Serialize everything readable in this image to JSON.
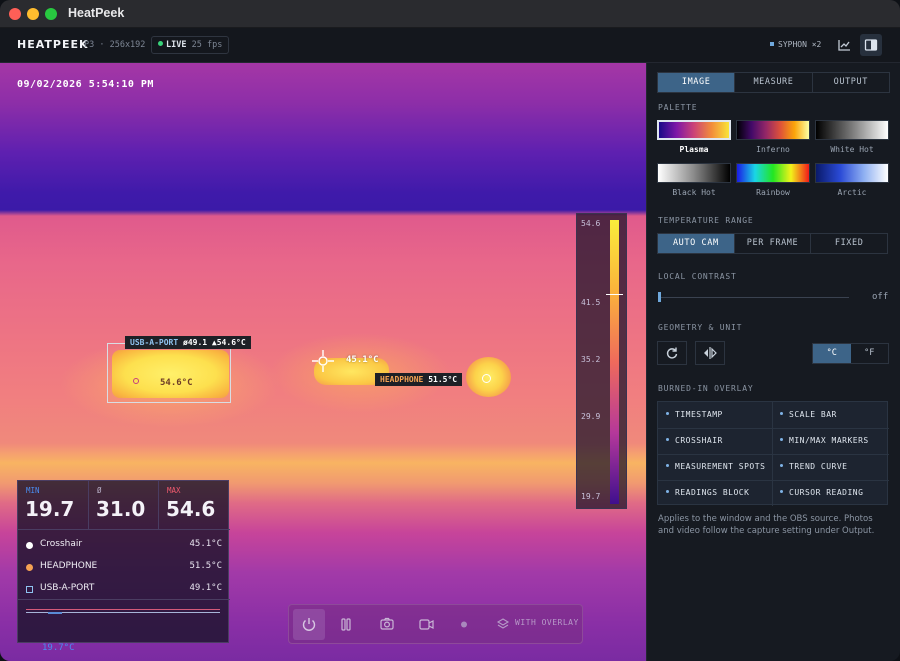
{
  "window": {
    "title": "HeatPeek"
  },
  "header": {
    "brand": "HEATPEEK",
    "camera": "P3 · 256x192",
    "live_label": "LIVE",
    "fps": "25 fps",
    "syphon": "SYPHON ×2"
  },
  "viewer": {
    "timestamp": "09/02/2026   5:54:10 PM",
    "usb_tag": {
      "name": "USB-A-PORT",
      "avg": "ø49.1",
      "max": "▲54.6°C"
    },
    "usb_point": "54.6°C",
    "crosshair_temp": "45.1°C",
    "headphone_tag": {
      "name": "HEADPHONE",
      "value": "51.5°C"
    },
    "scale_ticks": [
      "54.6",
      "41.5",
      "35.2",
      "29.9",
      "19.7"
    ],
    "scale_marker_value": 45.1,
    "palette_gradient": [
      "#f9ed3b",
      "#fbb33b",
      "#ef6a5c",
      "#b5389a",
      "#3f0f8e"
    ]
  },
  "readings": {
    "min_label": "MIN",
    "min_value": "19.7",
    "avg_label": "Ø",
    "avg_value": "31.0",
    "max_label": "MAX",
    "max_value": "54.6",
    "rows": [
      {
        "name": "Crosshair",
        "value": "45.1°C",
        "color": "#ffffff",
        "icon": "circle-icon"
      },
      {
        "name": "HEADPHONE",
        "value": "51.5°C",
        "color": "#f5a253",
        "icon": "circle-icon"
      },
      {
        "name": "USB-A-PORT",
        "value": "49.1°C",
        "color": "#8fc3f0",
        "icon": "square-icon"
      }
    ],
    "curve_min_label": "19.7°C"
  },
  "toolbar": {
    "buttons": [
      "power-icon",
      "pause-icon",
      "camera-icon",
      "video-icon",
      "record-dot-icon",
      "layers-icon"
    ],
    "overlay_label": "WITH OVERLAY"
  },
  "sidebar": {
    "tabs": [
      {
        "label": "IMAGE",
        "active": true
      },
      {
        "label": "MEASURE",
        "active": false
      },
      {
        "label": "OUTPUT",
        "active": false
      }
    ],
    "palette_title": "PALETTE",
    "palettes": [
      {
        "name": "Plasma",
        "selected": true
      },
      {
        "name": "Inferno",
        "selected": false
      },
      {
        "name": "White Hot",
        "selected": false
      },
      {
        "name": "Black Hot",
        "selected": false
      },
      {
        "name": "Rainbow",
        "selected": false
      },
      {
        "name": "Arctic",
        "selected": false
      }
    ],
    "range_title": "TEMPERATURE RANGE",
    "range_options": [
      {
        "label": "AUTO CAM",
        "active": true
      },
      {
        "label": "PER FRAME",
        "active": false
      },
      {
        "label": "FIXED",
        "active": false
      }
    ],
    "contrast_title": "LOCAL CONTRAST",
    "contrast_value": "off",
    "contrast_level": 0,
    "geometry_title": "GEOMETRY & UNIT",
    "units": [
      {
        "label": "°C",
        "active": true
      },
      {
        "label": "°F",
        "active": false
      }
    ],
    "overlay_title": "BURNED-IN OVERLAY",
    "overlay_items": [
      "TIMESTAMP",
      "SCALE BAR",
      "CROSSHAIR",
      "MIN/MAX MARKERS",
      "MEASUREMENT SPOTS",
      "TREND CURVE",
      "READINGS BLOCK",
      "CURSOR READING"
    ],
    "note": "Applies to the window and the OBS source. Photos and video follow the capture setting under Output."
  }
}
